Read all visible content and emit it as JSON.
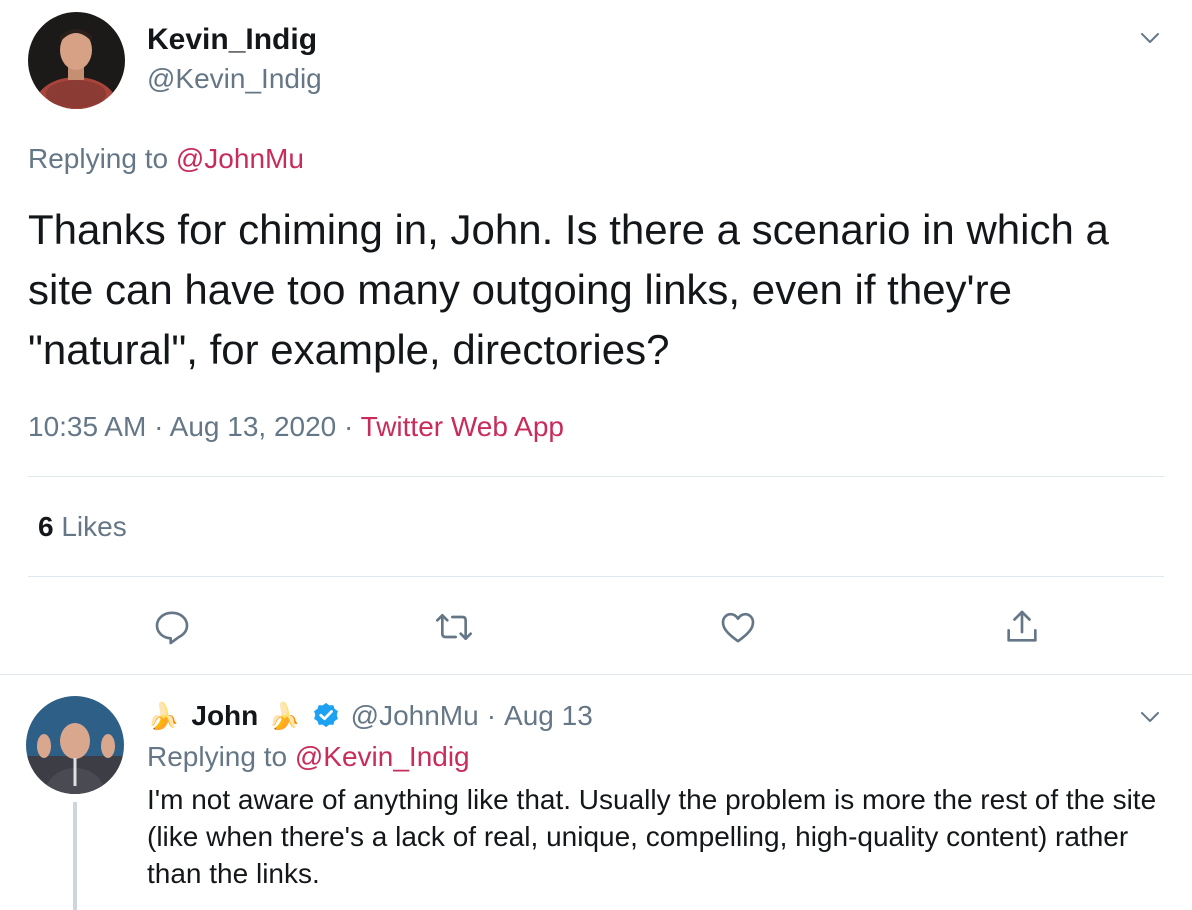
{
  "main_tweet": {
    "author": {
      "display_name": "Kevin_Indig",
      "handle": "@Kevin_Indig",
      "avatar_icon": "user-avatar-photo"
    },
    "replying_prefix": "Replying to ",
    "replying_to": "@JohnMu",
    "text": "Thanks for chiming in, John. Is there a scenario in which a site can have too many outgoing links, even if they're \"natural\", for example, directories?",
    "time": "10:35 AM",
    "separator": "·",
    "date": "Aug 13, 2020",
    "source": "Twitter Web App",
    "likes_count": "6",
    "likes_label": "Likes",
    "actions": [
      "reply-icon",
      "retweet-icon",
      "like-icon",
      "share-icon"
    ]
  },
  "reply_tweet": {
    "author": {
      "emoji_prefix": "🍌",
      "display_name": "John",
      "emoji_suffix": "🍌",
      "verified_icon": "verified-badge-icon",
      "handle": "@JohnMu",
      "avatar_icon": "user-avatar-photo"
    },
    "separator": "·",
    "date": "Aug 13",
    "replying_prefix": "Replying to ",
    "replying_to": "@Kevin_Indig",
    "text": "I'm not aware of anything like that. Usually the problem is more the rest of the site (like when there's a lack of real, unique, compelling, high-quality content) rather than the links."
  },
  "colors": {
    "accent": "#c92c5b",
    "muted": "#657786",
    "text": "#14171a",
    "divider": "#e1e8ed",
    "verified": "#1da1f2"
  }
}
